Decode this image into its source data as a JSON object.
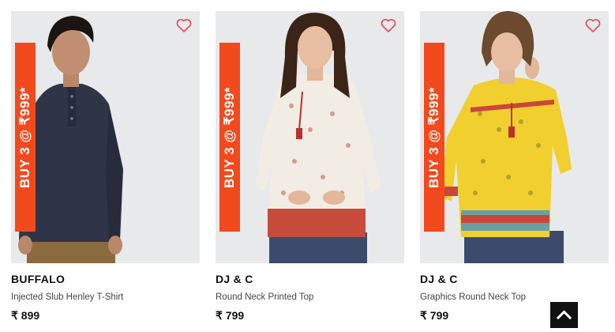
{
  "products": [
    {
      "brand": "BUFFALO",
      "name": "Injected Slub Henley T-Shirt",
      "price": "₹ 899",
      "promo": "BUY 3 @ ₹999*",
      "image_desc_colors": {
        "bg": "#e8e9eb",
        "garment": "#2f3547",
        "pants": "#8a6a3e"
      }
    },
    {
      "brand": "DJ & C",
      "name": "Round Neck Printed Top",
      "price": "₹ 799",
      "promo": "BUY 3 @ ₹999*",
      "image_desc_colors": {
        "bg": "#e8e9eb",
        "garment": "#f1ece4",
        "pants": "#3b4b6b"
      }
    },
    {
      "brand": "DJ & C",
      "name": "Graphics Round Neck Top",
      "price": "₹ 799",
      "promo": "BUY 3 @ ₹999*",
      "image_desc_colors": {
        "bg": "#e8e9eb",
        "garment": "#f0cf2f",
        "pants": "#3b4b6b"
      }
    }
  ],
  "icons": {
    "wishlist": "heart-outline-icon",
    "back_to_top": "chevron-up-icon"
  },
  "colors": {
    "promo_bg": "#f2491d",
    "wishlist_stroke": "#e0505a",
    "back_to_top_bg": "#111111"
  }
}
